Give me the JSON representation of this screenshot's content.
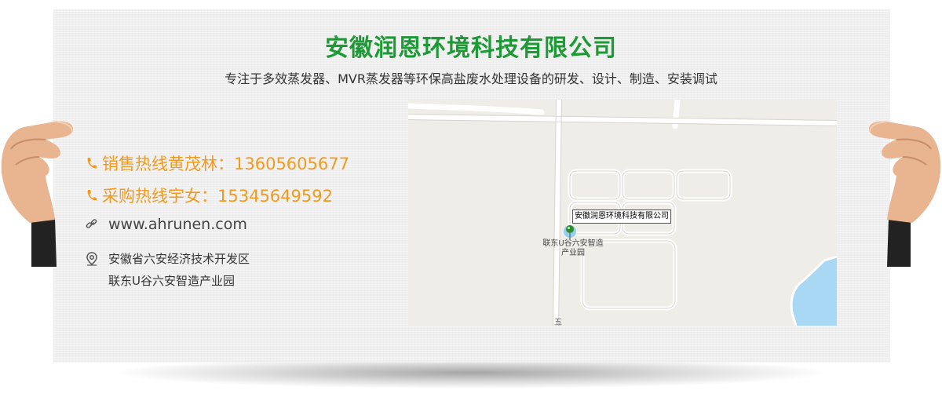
{
  "header": {
    "company_name": "安徽润恩环境科技有限公司",
    "tagline": "专注于多效蒸发器、MVR蒸发器等环保高盐废水处理设备的研发、设计、制造、安装调试"
  },
  "contacts": {
    "sales_hotline": "销售热线黄茂林：13605605677",
    "purchase_hotline": "采购热线宇女：15345649592",
    "website": "www.ahrunen.com",
    "address_line1": "安徽省六安经济技术开发区",
    "address_line2": "联东U谷六安智造产业园"
  },
  "map": {
    "marker_label": "安徽润恩环境科技有限公司",
    "poi_name": "联东U谷六安智造产业园",
    "road_label": "五"
  },
  "colors": {
    "brand_green": "#1d9a35",
    "hotline_orange": "#f29a1e",
    "map_water": "#a8d8f3"
  },
  "icons": {
    "phone": "phone-icon",
    "link": "link-icon",
    "location": "location-pin-icon",
    "map_marker": "map-marker-icon"
  }
}
